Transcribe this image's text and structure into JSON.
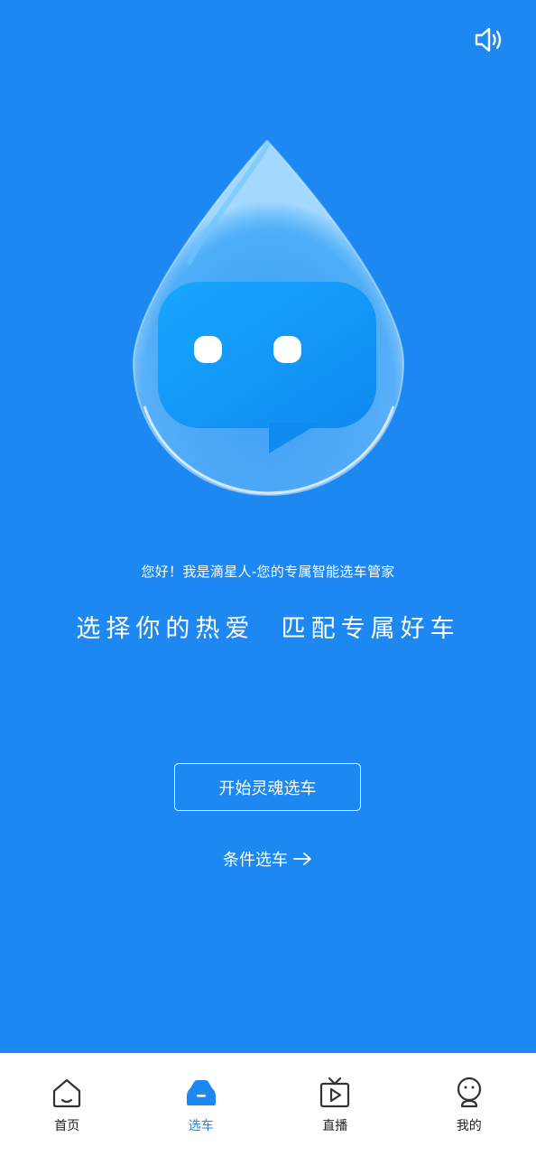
{
  "colors": {
    "background": "#1d88f2",
    "tabbar_bg": "#ffffff",
    "tab_active": "#1d88f2",
    "tab_inactive": "#222222"
  },
  "header": {
    "sound_icon": "speaker-icon"
  },
  "hero": {
    "mascot_icon": "water-drop-chat-bubble-mascot",
    "greeting": "您好！我是滴星人-您的专属智能选车管家",
    "slogan": "选择你的热爱  匹配专属好车"
  },
  "actions": {
    "start_label": "开始灵魂选车",
    "condition_label": "条件选车",
    "condition_icon": "arrow-right-icon"
  },
  "tabbar": {
    "active_index": 1,
    "items": [
      {
        "label": "首页",
        "icon": "home-icon"
      },
      {
        "label": "选车",
        "icon": "car-icon"
      },
      {
        "label": "直播",
        "icon": "tv-play-icon"
      },
      {
        "label": "我的",
        "icon": "profile-icon"
      }
    ]
  }
}
